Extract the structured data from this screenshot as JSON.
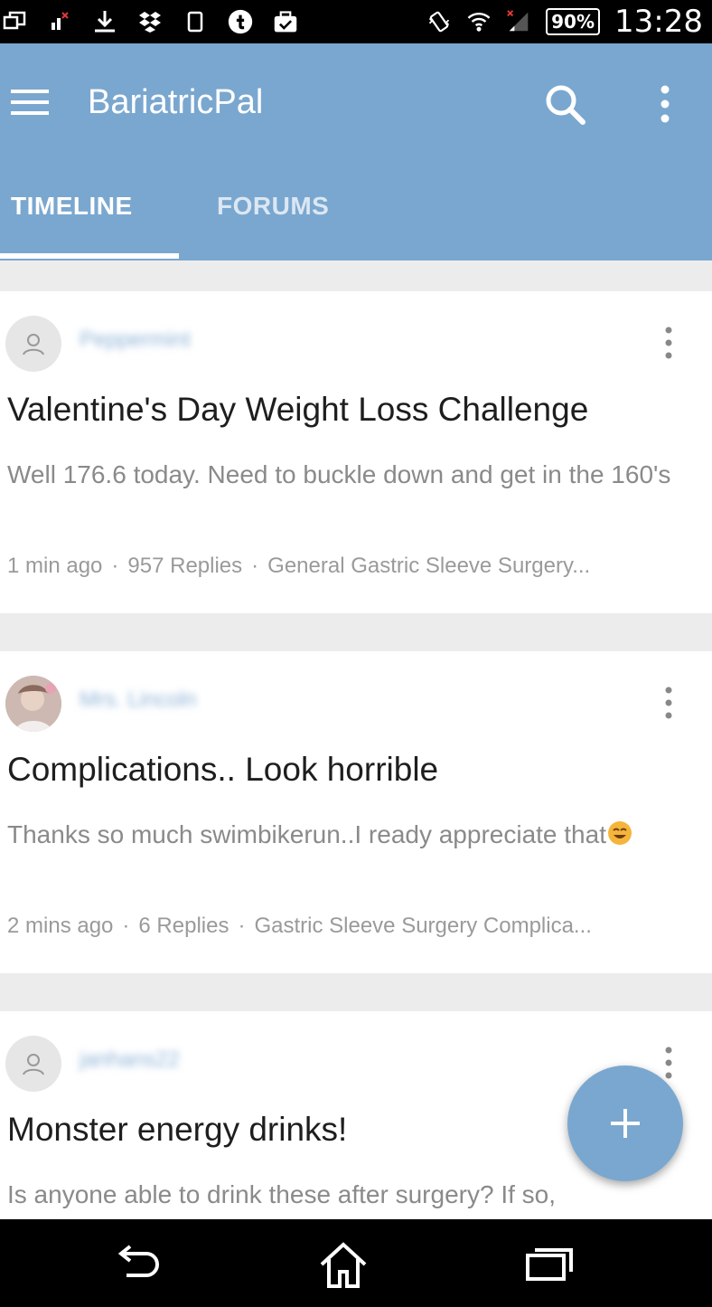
{
  "status_bar": {
    "battery": "90%",
    "time": "13:28",
    "left_icons": [
      "screen-mirror-icon",
      "signal-alert-icon",
      "download-icon",
      "dropbox-icon",
      "square-icon",
      "tumblr-icon",
      "briefcase-check-icon"
    ],
    "right_icons": [
      "vibrate-icon",
      "wifi-icon",
      "cell-signal-icon",
      "battery-icon"
    ]
  },
  "app_bar": {
    "title": "BariatricPal",
    "color": "#7aa7cf",
    "tabs": [
      {
        "label": "TIMELINE",
        "active": true
      },
      {
        "label": "FORUMS",
        "active": false
      }
    ]
  },
  "posts": [
    {
      "username": "Peppermint",
      "title": "Valentine's Day Weight Loss Challenge",
      "excerpt": "Well 176.6 today. Need to buckle down and get in the 160's",
      "time": "1 min ago",
      "replies": "957 Replies",
      "forum": "General Gastric Sleeve Surgery..."
    },
    {
      "username": "Mrs. Lincoln",
      "title": "Complications.. Look horrible",
      "excerpt": "Thanks so much swimbikerun..I ready appreciate that",
      "time": "2 mins ago",
      "replies": "6 Replies",
      "forum": "Gastric Sleeve Surgery Complica..."
    },
    {
      "username": "janhans22",
      "title": "Monster energy drinks!",
      "excerpt": "Is anyone able to drink these after surgery? If so,"
    }
  ],
  "meta_separator": "·",
  "fab": {
    "icon": "plus-icon"
  }
}
